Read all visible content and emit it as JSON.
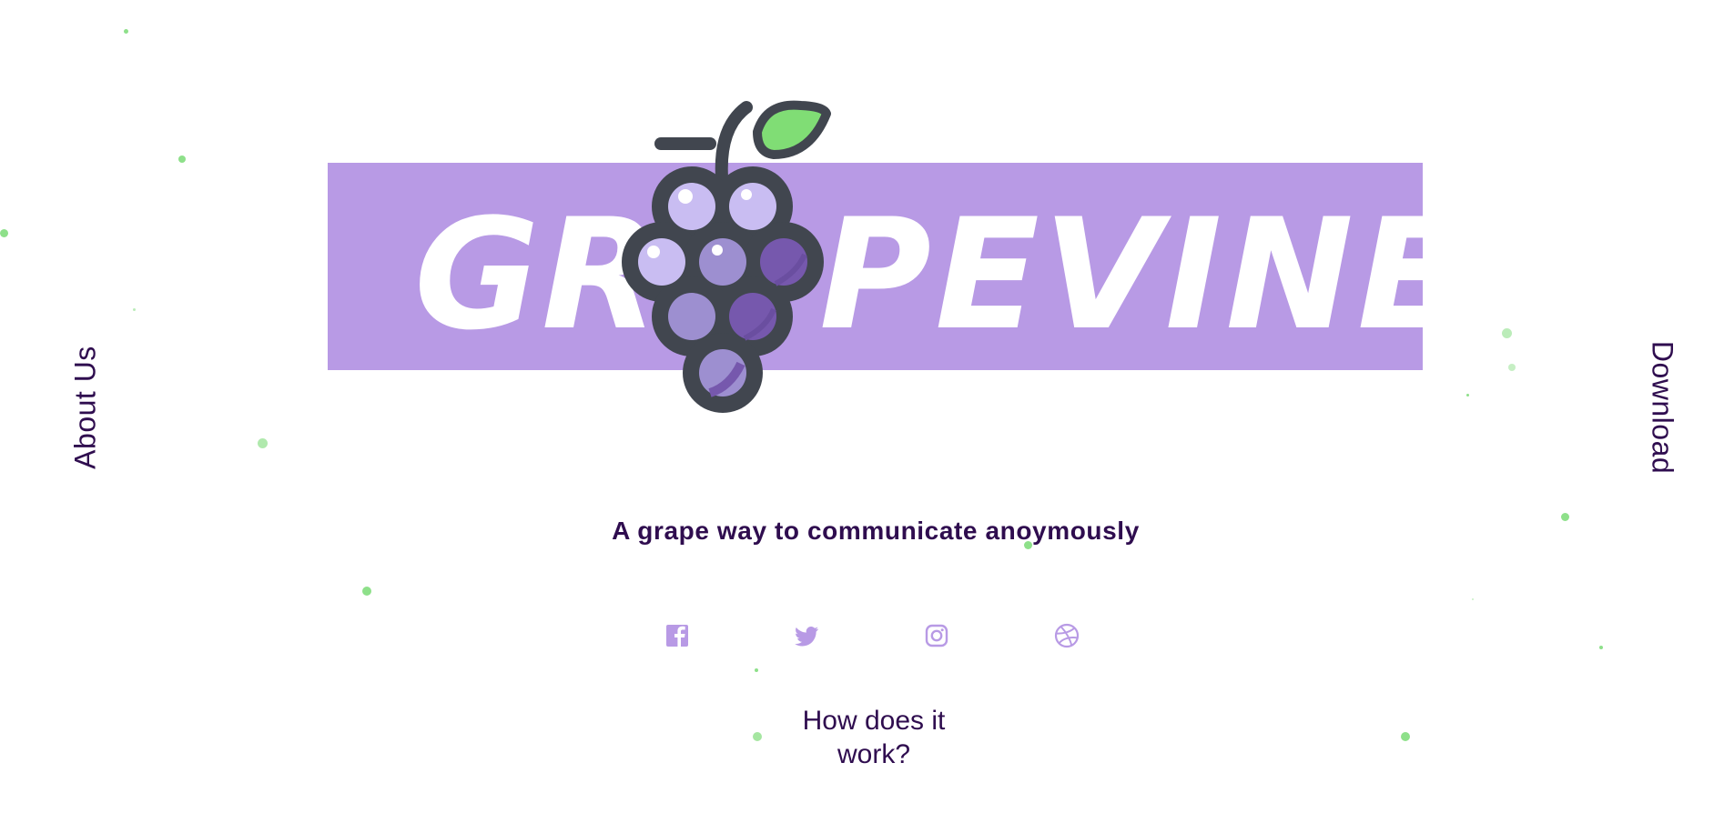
{
  "nav": {
    "about_label": "About Us",
    "download_label": "Download"
  },
  "logo": {
    "brand_name": "GRAPEVINE",
    "banner_color": "#b89ae5",
    "grape_outline_color": "#41464f",
    "leaf_color": "#80dd75"
  },
  "hero": {
    "tagline": "A grape way to communicate anoymously"
  },
  "social": {
    "icon_color": "#b89ae5",
    "items": [
      {
        "icon": "facebook-icon"
      },
      {
        "icon": "twitter-icon"
      },
      {
        "icon": "instagram-icon"
      },
      {
        "icon": "dribbble-icon"
      }
    ]
  },
  "cta": {
    "how_label": "How does it work?"
  },
  "colors": {
    "text": "#2f0d4f",
    "particles": "#8ee08a"
  }
}
